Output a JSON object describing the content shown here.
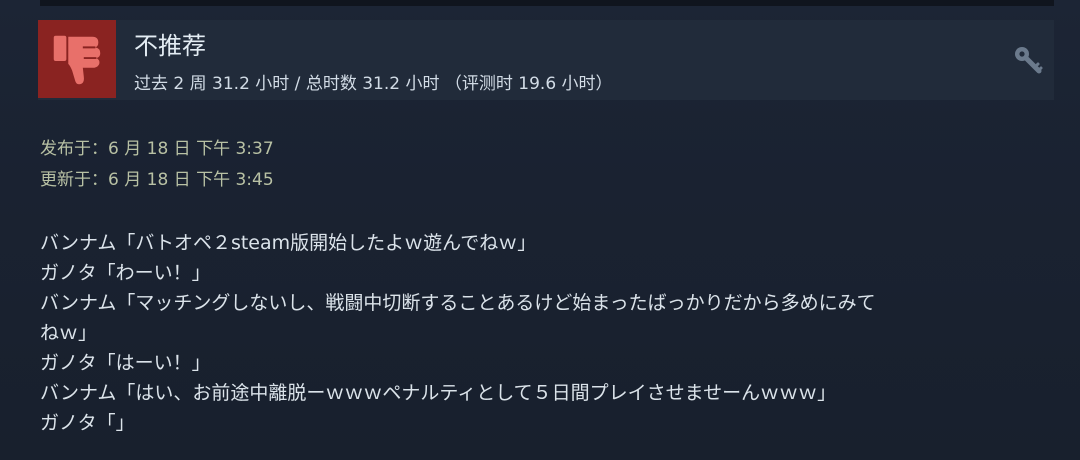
{
  "review": {
    "verdict": "不推荐",
    "hours_summary": "过去 2 周 31.2 小时 / 总时数 31.2 小时 （评测时 19.6 小时）",
    "posted": "发布于：6 月 18 日 下午 3:37",
    "updated": "更新于：6 月 18 日 下午 3:45",
    "body_lines": [
      "バンナム「バトオペ２steam版開始したよｗ遊んでねｗ」",
      "ガノタ「わーい！」",
      "バンナム「マッチングしないし、戦闘中切断することあるけど始まったばっかりだから多めにみて",
      "ねｗ」",
      "ガノタ「はーい！」",
      "バンナム「はい、お前途中離脱ーｗｗｗペナルティとして５日間プレイさせませーんｗｗｗ」",
      "ガノタ「」"
    ]
  },
  "icons": {
    "verdict_icon": "thumbs-down-icon",
    "product_key_icon": "key-icon"
  },
  "colors": {
    "thumb_box": "#8a2321",
    "thumb_glyph": "#e8706a",
    "header_bg": "#212b3a"
  }
}
